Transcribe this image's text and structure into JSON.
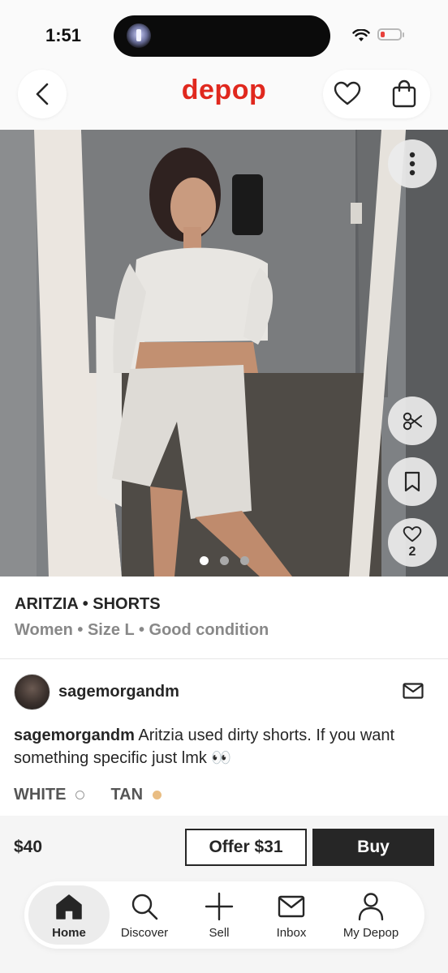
{
  "status_bar": {
    "time": "1:51"
  },
  "header": {
    "logo": "depop"
  },
  "photo": {
    "image_count": 3,
    "active_index": 0,
    "like_count": "2"
  },
  "listing": {
    "title": "ARITZIA • SHORTS",
    "subtitle": "Women • Size L • Good condition"
  },
  "seller": {
    "username": "sagemorgandm",
    "description_user": "sagemorgandm",
    "description_text": " Aritzia used dirty shorts. If you want something specific just lmk 👀"
  },
  "colors": [
    {
      "label": "WHITE",
      "swatch": "#ffffff"
    },
    {
      "label": "TAN",
      "swatch": "#e9bd83"
    }
  ],
  "purchase": {
    "price": "$40",
    "offer_label": "Offer $31",
    "buy_label": "Buy"
  },
  "tabs": [
    {
      "label": "Home",
      "icon": "home-icon",
      "active": true
    },
    {
      "label": "Discover",
      "icon": "search-icon",
      "active": false
    },
    {
      "label": "Sell",
      "icon": "plus-icon",
      "active": false
    },
    {
      "label": "Inbox",
      "icon": "mail-icon",
      "active": false
    },
    {
      "label": "My Depop",
      "icon": "user-icon",
      "active": false
    }
  ],
  "theme": {
    "brand": "#e0281e",
    "text": "#262626"
  }
}
